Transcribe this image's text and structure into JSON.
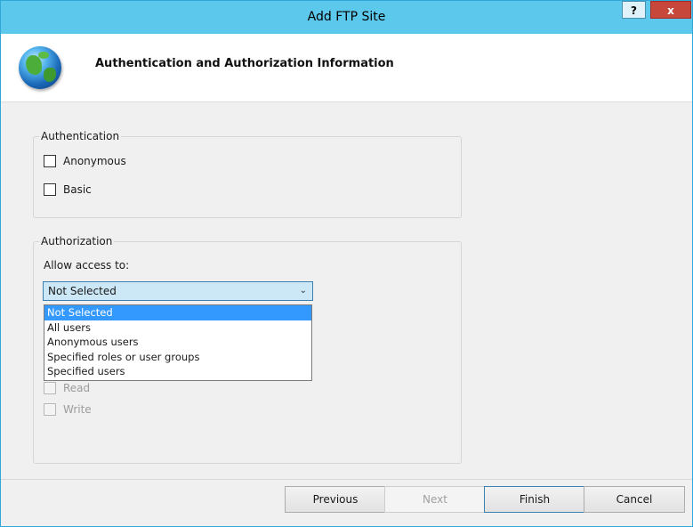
{
  "window": {
    "title": "Add FTP Site",
    "help_label": "?",
    "close_label": "x"
  },
  "header": {
    "title": "Authentication and Authorization Information",
    "icon": "globe-icon"
  },
  "authentication": {
    "legend": "Authentication",
    "options": [
      {
        "label": "Anonymous",
        "checked": false
      },
      {
        "label": "Basic",
        "checked": false
      }
    ]
  },
  "authorization": {
    "legend": "Authorization",
    "allow_access_label": "Allow access to:",
    "selected_value": "Not Selected",
    "dropdown_options": [
      "Not Selected",
      "All users",
      "Anonymous users",
      "Specified roles or user groups",
      "Specified users"
    ],
    "permissions": [
      {
        "label": "Read",
        "checked": false,
        "enabled": false
      },
      {
        "label": "Write",
        "checked": false,
        "enabled": false
      }
    ]
  },
  "buttons": {
    "previous": "Previous",
    "next": "Next",
    "finish": "Finish",
    "cancel": "Cancel"
  },
  "colors": {
    "titlebar": "#5bc8ec",
    "selection": "#3399ff",
    "close": "#c7473a"
  }
}
